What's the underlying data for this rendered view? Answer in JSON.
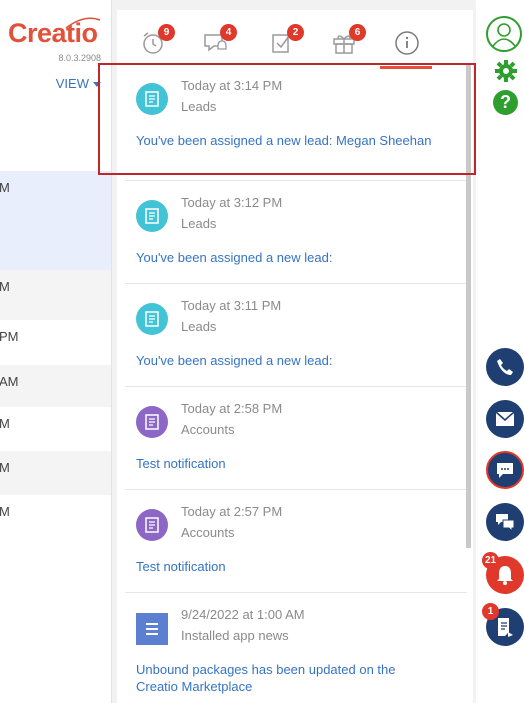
{
  "app": {
    "logo_text": "Creatio",
    "version": "8.0.3.2908",
    "view_label": "VIEW"
  },
  "left_rows": [
    {
      "text": "M",
      "bg": "#e8eefb"
    },
    {
      "text": "M",
      "bg": "#f4f4f4"
    },
    {
      "text": "PM",
      "bg": "#ffffff"
    },
    {
      "text": "AM",
      "bg": "#f4f4f4"
    },
    {
      "text": "M",
      "bg": "#ffffff"
    },
    {
      "text": "M",
      "bg": "#f4f4f4"
    },
    {
      "text": "M",
      "bg": "#ffffff"
    }
  ],
  "tabs": [
    {
      "name": "reminders",
      "icon": "alarm-clock-icon",
      "badge": "9"
    },
    {
      "name": "feed",
      "icon": "chat-bell-icon",
      "badge": "4"
    },
    {
      "name": "tasks",
      "icon": "checkbox-icon",
      "badge": "2"
    },
    {
      "name": "celebrations",
      "icon": "gift-icon",
      "badge": "6"
    },
    {
      "name": "info",
      "icon": "info-icon",
      "badge": ""
    }
  ],
  "notifications": [
    {
      "time": "Today at 3:14 PM",
      "category": "Leads",
      "message": "You've been assigned a new lead: Megan Sheehan",
      "type": "lead"
    },
    {
      "time": "Today at 3:12 PM",
      "category": "Leads",
      "message": "You've been assigned a new lead:",
      "type": "lead"
    },
    {
      "time": "Today at 3:11 PM",
      "category": "Leads",
      "message": "You've been assigned a new lead:",
      "type": "lead"
    },
    {
      "time": "Today at 2:58 PM",
      "category": "Accounts",
      "message": "Test notification",
      "type": "acct"
    },
    {
      "time": "Today at 2:57 PM",
      "category": "Accounts",
      "message": "Test notification",
      "type": "acct"
    },
    {
      "time": "9/24/2022 at 1:00 AM",
      "category": "Installed app news",
      "message": "Unbound packages has been updated on the Creatio Marketplace",
      "type": "news"
    }
  ],
  "right_bar": {
    "notifications_badge": "21",
    "process_badge": "1"
  },
  "colors": {
    "accent": "#e2513a",
    "link": "#3574c4",
    "dark_button": "#1f3f73",
    "badge": "#e0382b",
    "green": "#2e9e2e"
  }
}
